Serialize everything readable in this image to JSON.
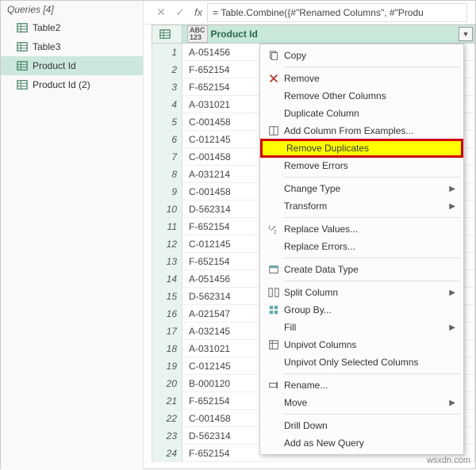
{
  "sidebar": {
    "header": "Queries [4]",
    "items": [
      {
        "label": "Table2"
      },
      {
        "label": "Table3"
      },
      {
        "label": "Product Id"
      },
      {
        "label": "Product Id (2)"
      }
    ],
    "selected_index": 2
  },
  "formula_bar": {
    "formula": "= Table.Combine({#\"Renamed Columns\", #\"Produ"
  },
  "grid": {
    "column_header": "Product Id",
    "type_label": "ABC\n123",
    "rows": [
      "A-051456",
      "F-652154",
      "F-652154",
      "A-031021",
      "C-001458",
      "C-012145",
      "C-001458",
      "A-031214",
      "C-001458",
      "D-562314",
      "F-652154",
      "C-012145",
      "F-652154",
      "A-051456",
      "D-562314",
      "A-021547",
      "A-032145",
      "A-031021",
      "C-012145",
      "B-000120",
      "F-652154",
      "C-001458",
      "D-562314",
      "F-652154"
    ]
  },
  "context_menu": {
    "items": [
      {
        "label": "Copy",
        "icon": "copy"
      },
      {
        "sep": true
      },
      {
        "label": "Remove",
        "icon": "remove"
      },
      {
        "label": "Remove Other Columns"
      },
      {
        "label": "Duplicate Column"
      },
      {
        "label": "Add Column From Examples...",
        "icon": "addcol"
      },
      {
        "label": "Remove Duplicates",
        "highlight": true
      },
      {
        "label": "Remove Errors"
      },
      {
        "sep": true
      },
      {
        "label": "Change Type",
        "submenu": true
      },
      {
        "label": "Transform",
        "submenu": true
      },
      {
        "sep": true
      },
      {
        "label": "Replace Values...",
        "icon": "replace"
      },
      {
        "label": "Replace Errors..."
      },
      {
        "sep": true
      },
      {
        "label": "Create Data Type",
        "icon": "datatype"
      },
      {
        "sep": true
      },
      {
        "label": "Split Column",
        "icon": "split",
        "submenu": true
      },
      {
        "label": "Group By...",
        "icon": "group"
      },
      {
        "label": "Fill",
        "submenu": true
      },
      {
        "label": "Unpivot Columns",
        "icon": "unpivot"
      },
      {
        "label": "Unpivot Only Selected Columns"
      },
      {
        "sep": true
      },
      {
        "label": "Rename...",
        "icon": "rename"
      },
      {
        "label": "Move",
        "submenu": true
      },
      {
        "sep": true
      },
      {
        "label": "Drill Down"
      },
      {
        "label": "Add as New Query"
      }
    ]
  },
  "watermark": "wsxdn.com"
}
